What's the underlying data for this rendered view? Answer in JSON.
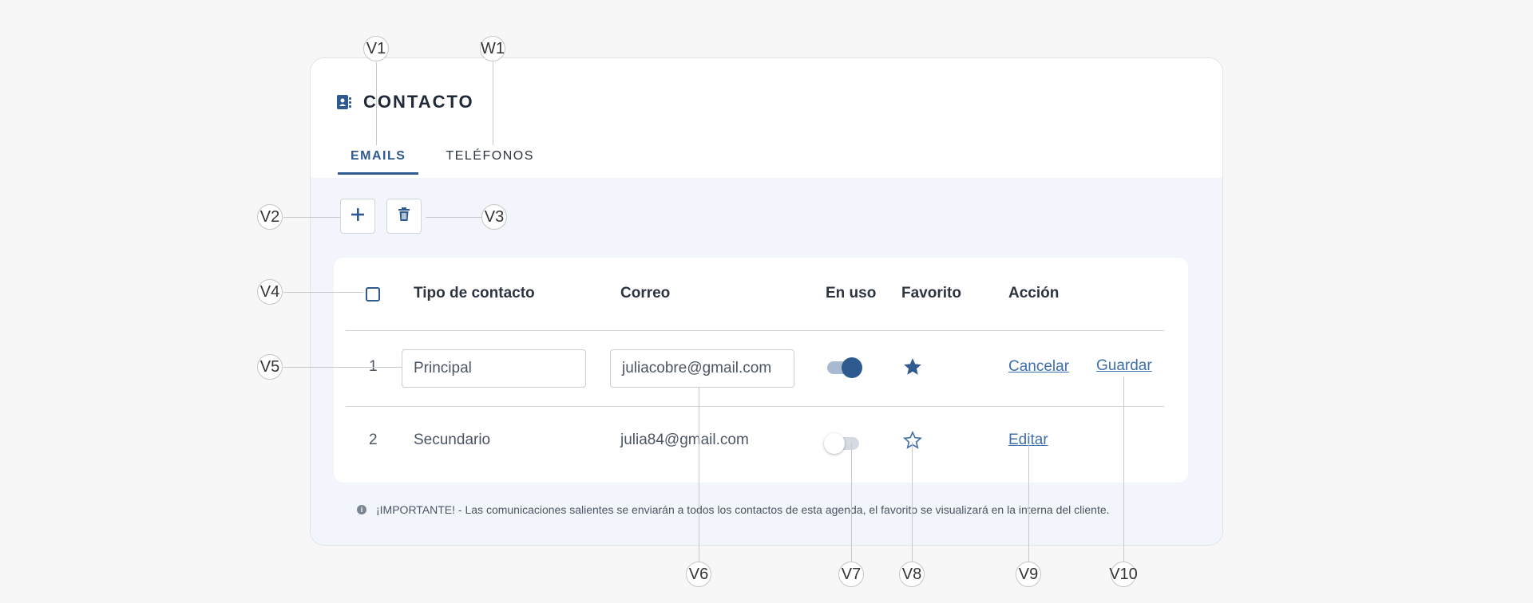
{
  "header": {
    "title": "CONTACTO",
    "icon": "contact-book-icon"
  },
  "tabs": [
    {
      "label": "EMAILS",
      "active": true
    },
    {
      "label": "TELÉFONOS",
      "active": false
    }
  ],
  "toolbar": {
    "add_icon": "plus-icon",
    "delete_icon": "trash-icon"
  },
  "table": {
    "columns": {
      "type": "Tipo de contacto",
      "email": "Correo",
      "in_use": "En uso",
      "favorite": "Favorito",
      "action": "Acción"
    },
    "rows": [
      {
        "number": "1",
        "type": "Principal",
        "email": "juliacobre@gmail.com",
        "in_use": true,
        "favorite": true,
        "actions": [
          "Cancelar",
          "Guardar"
        ],
        "editing": true
      },
      {
        "number": "2",
        "type": "Secundario",
        "email": "julia84@gmail.com",
        "in_use": false,
        "favorite": false,
        "actions": [
          "Editar"
        ],
        "editing": false
      }
    ]
  },
  "note": "¡IMPORTANTE! - Las comunicaciones salientes se enviarán a todos los contactos de esta agenda, el favorito se visualizará en la interna del cliente.",
  "callouts": {
    "v1": "V1",
    "w1": "W1",
    "v2": "V2",
    "v3": "V3",
    "v4": "V4",
    "v5": "V5",
    "v6": "V6",
    "v7": "V7",
    "v8": "V8",
    "v9": "V9",
    "v10": "V10"
  },
  "colors": {
    "accent": "#2f5a8f",
    "link": "#3f6fa8",
    "body_bg": "#f2f5fb"
  }
}
